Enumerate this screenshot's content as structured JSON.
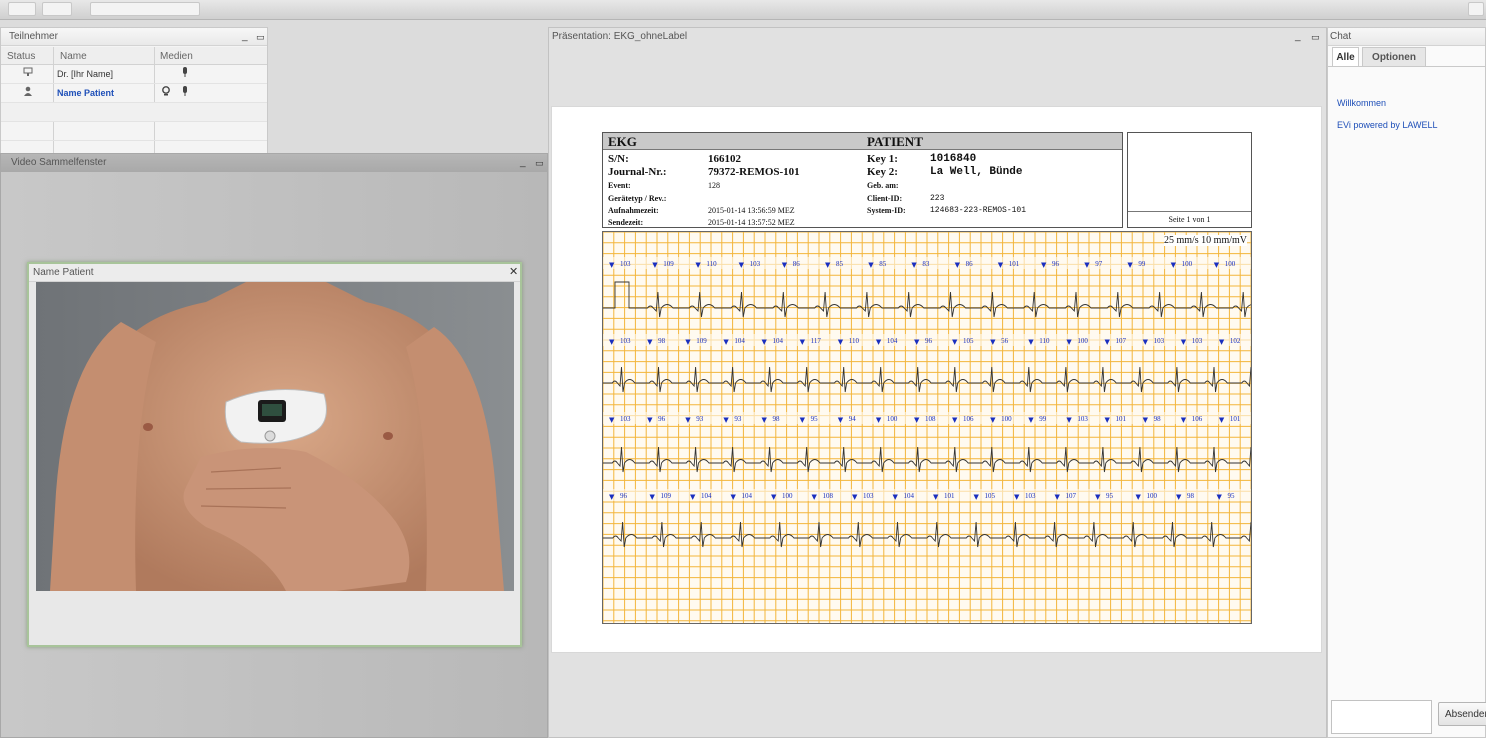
{
  "participants_panel": {
    "title": "Teilnehmer",
    "columns": [
      "Status",
      "Name",
      "Medien"
    ],
    "rows": [
      {
        "name": "Dr. [Ihr Name]",
        "highlight": false
      },
      {
        "name": "Name Patient",
        "highlight": true
      }
    ]
  },
  "video_collection": {
    "title": "Video Sammelfenster"
  },
  "patient_video": {
    "title": "Name Patient",
    "close_symbol": "✕"
  },
  "presentation": {
    "title": "Präsentation: EKG_ohneLabel",
    "ecg": {
      "header_left": "EKG",
      "header_right": "PATIENT",
      "left_fields": [
        {
          "label": "S/N:",
          "value": "166102"
        },
        {
          "label": "Journal-Nr.:",
          "value": "79372-REMOS-101"
        },
        {
          "label": "Event:",
          "value": "128"
        },
        {
          "label": "Gerätetyp / Rev.:",
          "value": ""
        },
        {
          "label": "Aufnahmezeit:",
          "value": "2015-01-14 13:56:59 MEZ"
        },
        {
          "label": "Sendezeit:",
          "value": "2015-01-14 13:57:52 MEZ"
        }
      ],
      "right_fields": [
        {
          "label": "Key 1:",
          "value": "1016840"
        },
        {
          "label": "Key 2:",
          "value": "La Well, Bünde"
        },
        {
          "label": "Geb. am:",
          "value": ""
        },
        {
          "label": "Client-ID:",
          "value": "223"
        },
        {
          "label": "System-ID:",
          "value": "124683-223-REMOS-101"
        }
      ],
      "page_label": "Seite 1 von 1",
      "scale_label": "25 mm/s 10 mm/mV",
      "strip_hr_labels": [
        [
          "103",
          "109",
          "110",
          "103",
          "86",
          "85",
          "85",
          "83",
          "86",
          "101",
          "96",
          "97",
          "99",
          "100",
          "100"
        ],
        [
          "103",
          "98",
          "109",
          "104",
          "104",
          "117",
          "110",
          "104",
          "96",
          "105",
          "56",
          "110",
          "100",
          "107",
          "103",
          "103",
          "102"
        ],
        [
          "103",
          "96",
          "93",
          "93",
          "98",
          "95",
          "94",
          "100",
          "108",
          "106",
          "100",
          "99",
          "103",
          "101",
          "98",
          "106",
          "101"
        ],
        [
          "96",
          "109",
          "104",
          "104",
          "100",
          "108",
          "103",
          "104",
          "101",
          "105",
          "103",
          "107",
          "95",
          "100",
          "98",
          "95"
        ]
      ]
    }
  },
  "chat": {
    "title": "Chat",
    "tabs": [
      "Alle",
      "Optionen"
    ],
    "messages": [
      "Willkommen",
      "EVi powered by LAWELL"
    ],
    "input_value": "",
    "send_label": "Absenden"
  },
  "colors": {
    "link_blue": "#1e4fb8",
    "ecg_grid": "#f3b53a",
    "beat_marker": "#1a2fbf"
  }
}
